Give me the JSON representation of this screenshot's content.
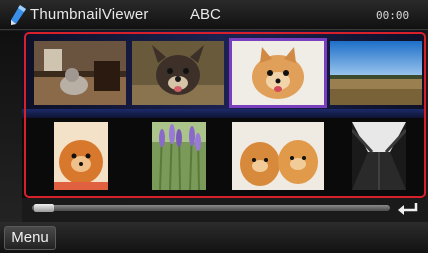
{
  "header": {
    "app_title": "ThumbnailViewer",
    "folder_name": "ABC",
    "clock": "00:00",
    "app_icon": "pencil-icon"
  },
  "thumbnails": [
    {
      "subject": "dog-indoors",
      "selected": false
    },
    {
      "subject": "french-bulldog",
      "selected": false
    },
    {
      "subject": "pomeranian-face",
      "selected": true
    },
    {
      "subject": "field-landscape",
      "selected": false
    },
    {
      "subject": "pomeranian-orange",
      "selected": false
    },
    {
      "subject": "lavender-flowers",
      "selected": false
    },
    {
      "subject": "two-pomeranians",
      "selected": false
    },
    {
      "subject": "bridge-walkway",
      "selected": false
    }
  ],
  "scroll": {
    "position": 0.0
  },
  "footer": {
    "menu_label": "Menu",
    "return_icon": "return-arrow-icon"
  },
  "colors": {
    "selection": "#7a3fbf",
    "highlight_frame": "#d8202a",
    "band": "#1b2252"
  }
}
